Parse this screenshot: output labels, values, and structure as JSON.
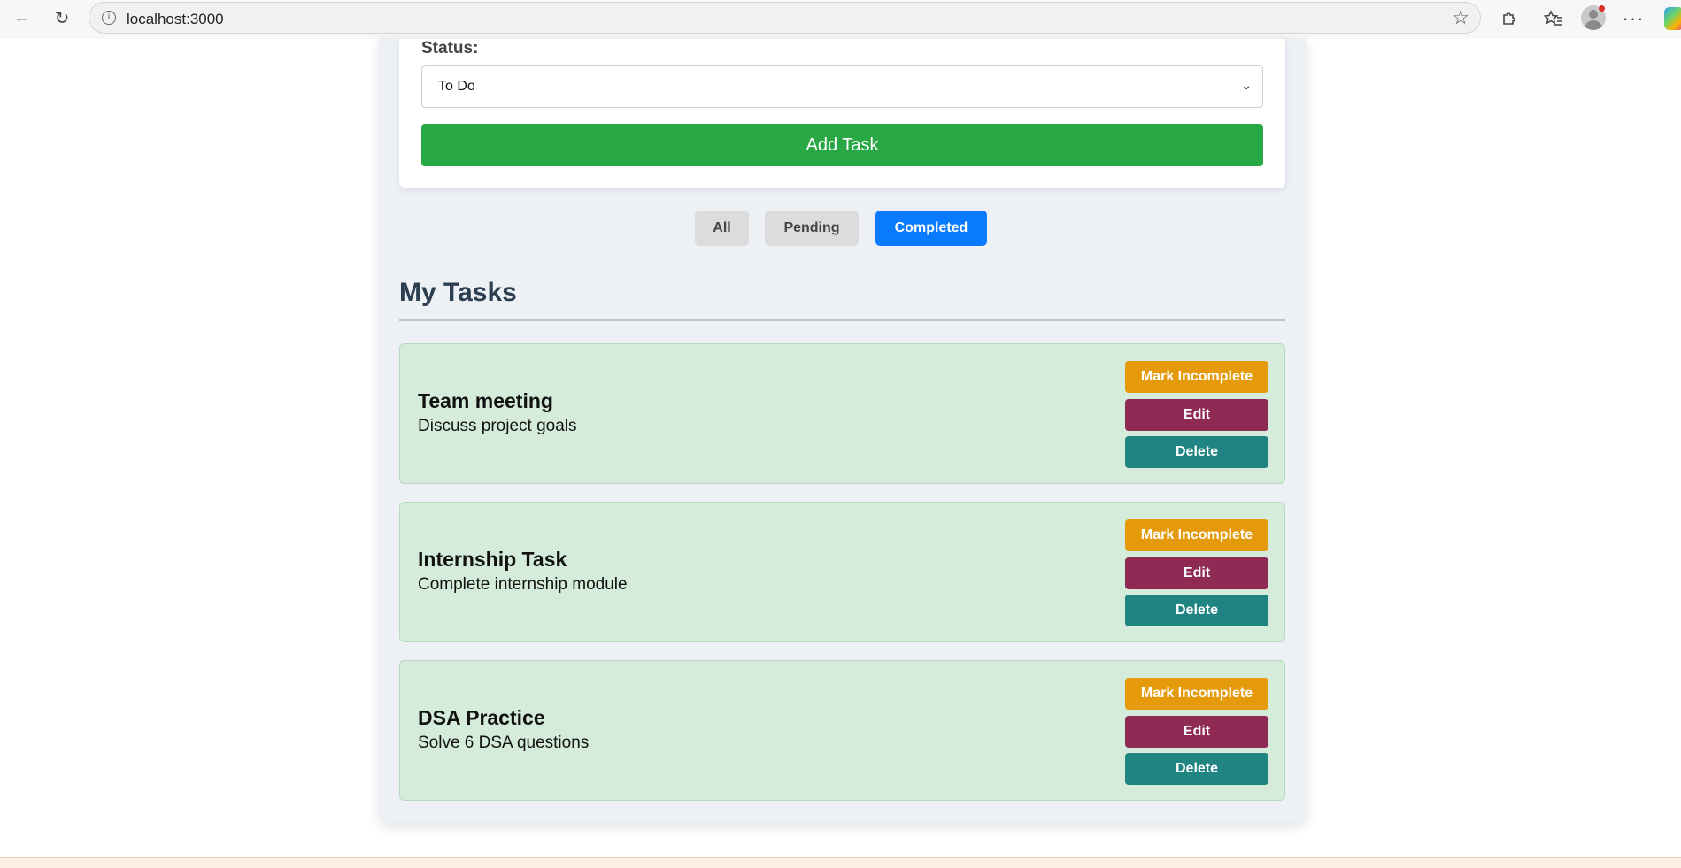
{
  "browser": {
    "url": "localhost:3000",
    "back_icon": "arrow-left-icon",
    "reload_icon": "reload-icon",
    "info_icon": "info-icon",
    "favorite_icon": "star-icon",
    "extensions_icon": "puzzle-icon",
    "favorites_icon": "favorites-list-icon",
    "menu_icon": "more-icon"
  },
  "form": {
    "status_label": "Status:",
    "status_selected": "To Do",
    "add_button": "Add Task"
  },
  "filters": {
    "all": "All",
    "pending": "Pending",
    "completed": "Completed",
    "active": "Completed"
  },
  "tasks_heading": "My Tasks",
  "tasks": [
    {
      "title": "Team meeting",
      "description": "Discuss project goals",
      "mark_label": "Mark Incomplete",
      "edit_label": "Edit",
      "delete_label": "Delete"
    },
    {
      "title": "Internship Task",
      "description": "Complete internship module",
      "mark_label": "Mark Incomplete",
      "edit_label": "Edit",
      "delete_label": "Delete"
    },
    {
      "title": "DSA Practice",
      "description": "Solve 6 DSA questions",
      "mark_label": "Mark Incomplete",
      "edit_label": "Edit",
      "delete_label": "Delete"
    }
  ],
  "colors": {
    "add_button": "#28a745",
    "filter_active": "#0a7bff",
    "filter_inactive": "#dcdcdc",
    "card_completed": "#d4ecd9",
    "mark_incomplete": "#e59a0c",
    "edit": "#8f2a55",
    "delete": "#208582",
    "heading": "#2c3e50"
  }
}
